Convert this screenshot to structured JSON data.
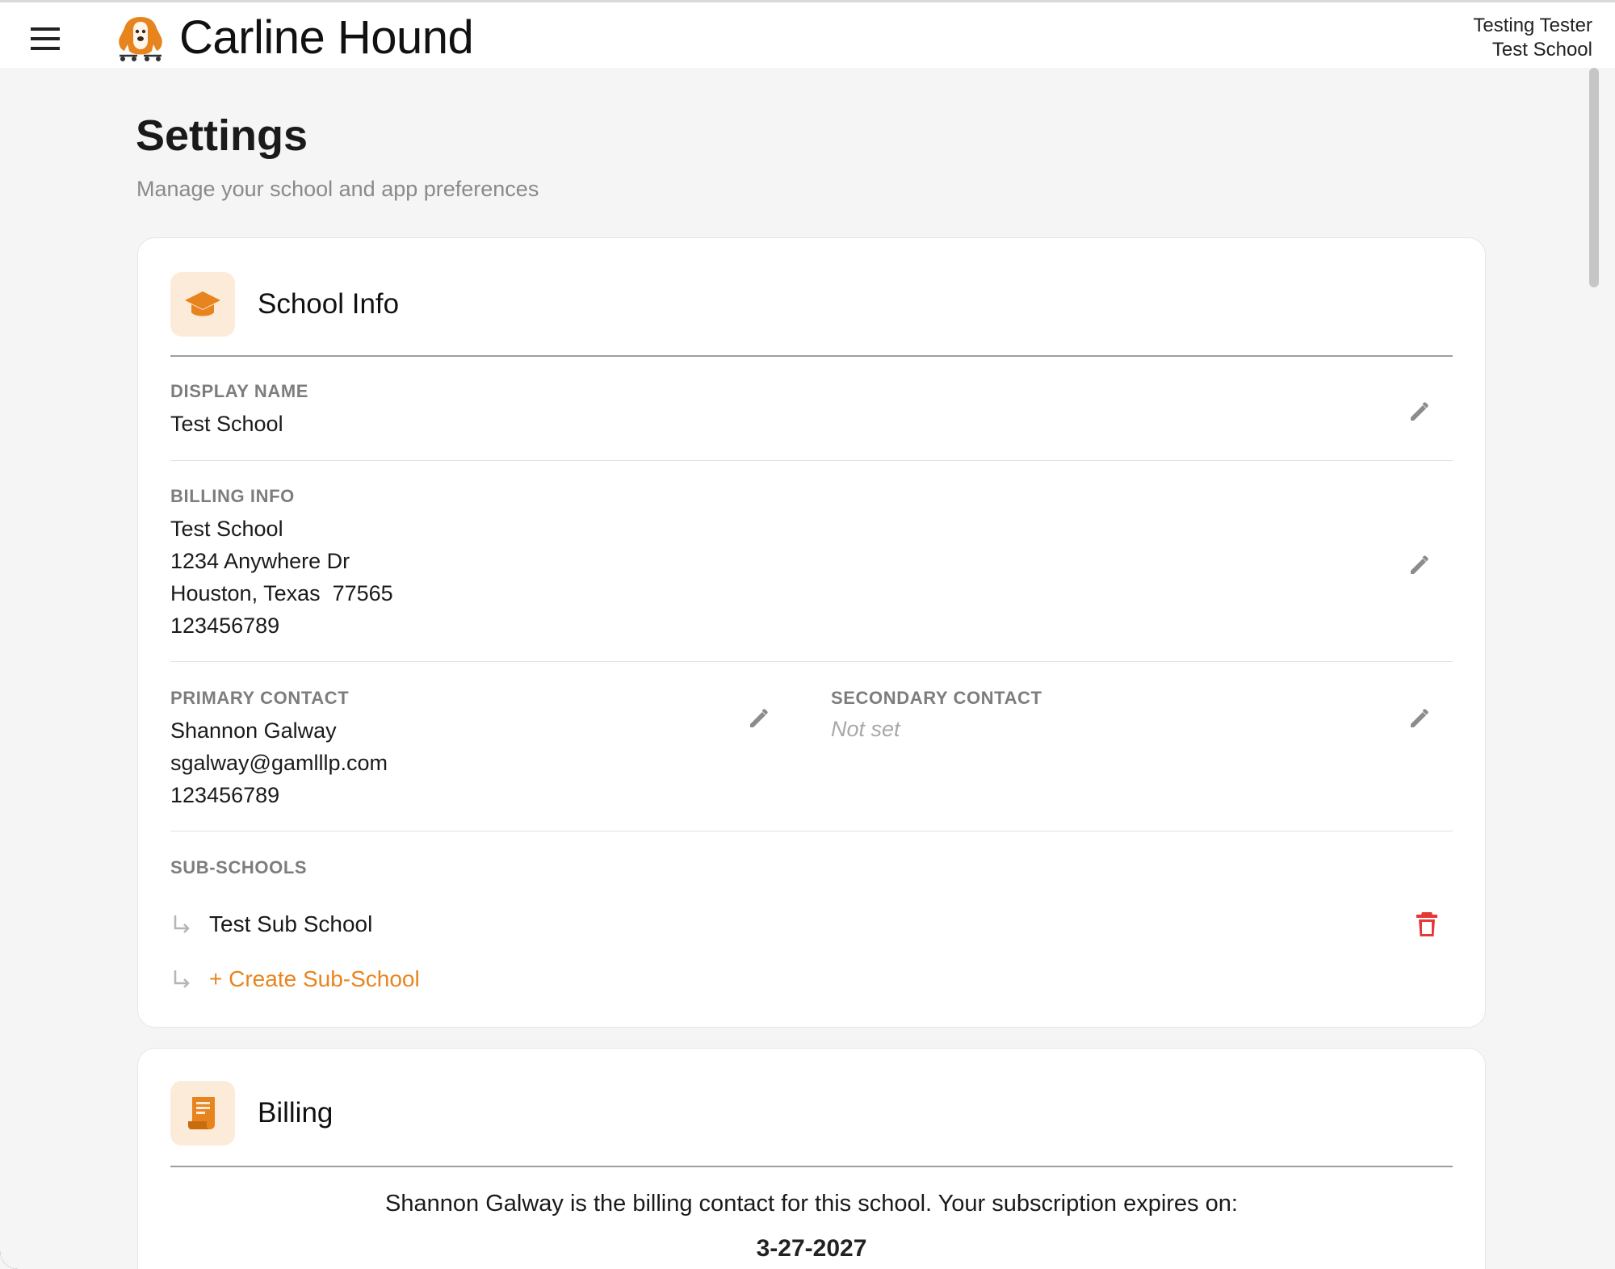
{
  "app": {
    "title": "Carline Hound",
    "user_name": "Testing Tester",
    "user_school": "Test School",
    "accent_color": "#e8841e",
    "danger_color": "#e53935"
  },
  "header": {
    "menu_icon": "hamburger-menu-icon",
    "logo_icon": "hound-logo-icon"
  },
  "page": {
    "title": "Settings",
    "subtitle": "Manage your school and app preferences"
  },
  "school_info": {
    "title": "School Info",
    "icon": "graduation-cap-icon",
    "display_name": {
      "label": "DISPLAY NAME",
      "value": "Test School"
    },
    "billing_info": {
      "label": "BILLING INFO",
      "lines": [
        "Test School",
        "1234 Anywhere Dr",
        "Houston, Texas  77565",
        "123456789"
      ]
    },
    "primary_contact": {
      "label": "PRIMARY CONTACT",
      "lines": [
        "Shannon Galway",
        "sgalway@gamlllp.com",
        "123456789"
      ]
    },
    "secondary_contact": {
      "label": "SECONDARY CONTACT",
      "value": "Not set"
    },
    "sub_schools": {
      "label": "SUB-SCHOOLS",
      "items": [
        {
          "name": "Test Sub School"
        }
      ],
      "create_label": "+ Create Sub-School"
    }
  },
  "billing": {
    "title": "Billing",
    "icon": "receipt-icon",
    "message": "Shannon Galway is the billing contact for this school. Your subscription expires on:",
    "expiry": "3-27-2027"
  }
}
